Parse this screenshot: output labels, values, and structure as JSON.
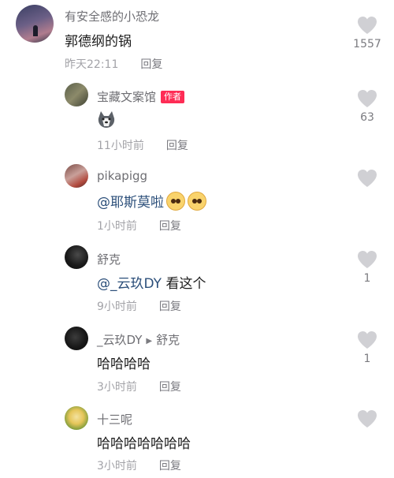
{
  "comments": [
    {
      "username": "有安全感的小恐龙",
      "text": "郭德纲的锅",
      "time": "昨天22:11",
      "reply": "回复",
      "likes": "1557"
    },
    {
      "username": "宝藏文案馆",
      "badge": "作者",
      "sticker": "husky-dog-sticker",
      "time": "11小时前",
      "reply": "回复",
      "likes": "63"
    },
    {
      "username": "pikapigg",
      "mention": "@耶斯莫啦",
      "emojis": [
        "sly-smile-emoji",
        "sly-smile-emoji"
      ],
      "time": "1小时前",
      "reply": "回复",
      "likes": ""
    },
    {
      "username": "舒克",
      "mention": "@_云玖DY",
      "text": " 看这个",
      "time": "9小时前",
      "reply": "回复",
      "likes": "1"
    },
    {
      "username": "_云玖DY",
      "reply_to": "舒克",
      "text": "哈哈哈哈",
      "time": "3小时前",
      "reply": "回复",
      "likes": "1"
    },
    {
      "username": "十三呢",
      "text": "哈哈哈哈哈哈哈",
      "time": "3小时前",
      "reply": "回复",
      "likes": ""
    }
  ],
  "colors": {
    "accent": "#fe2c55",
    "mention": "#2c4f7a",
    "heart": "#d0d0d4"
  }
}
